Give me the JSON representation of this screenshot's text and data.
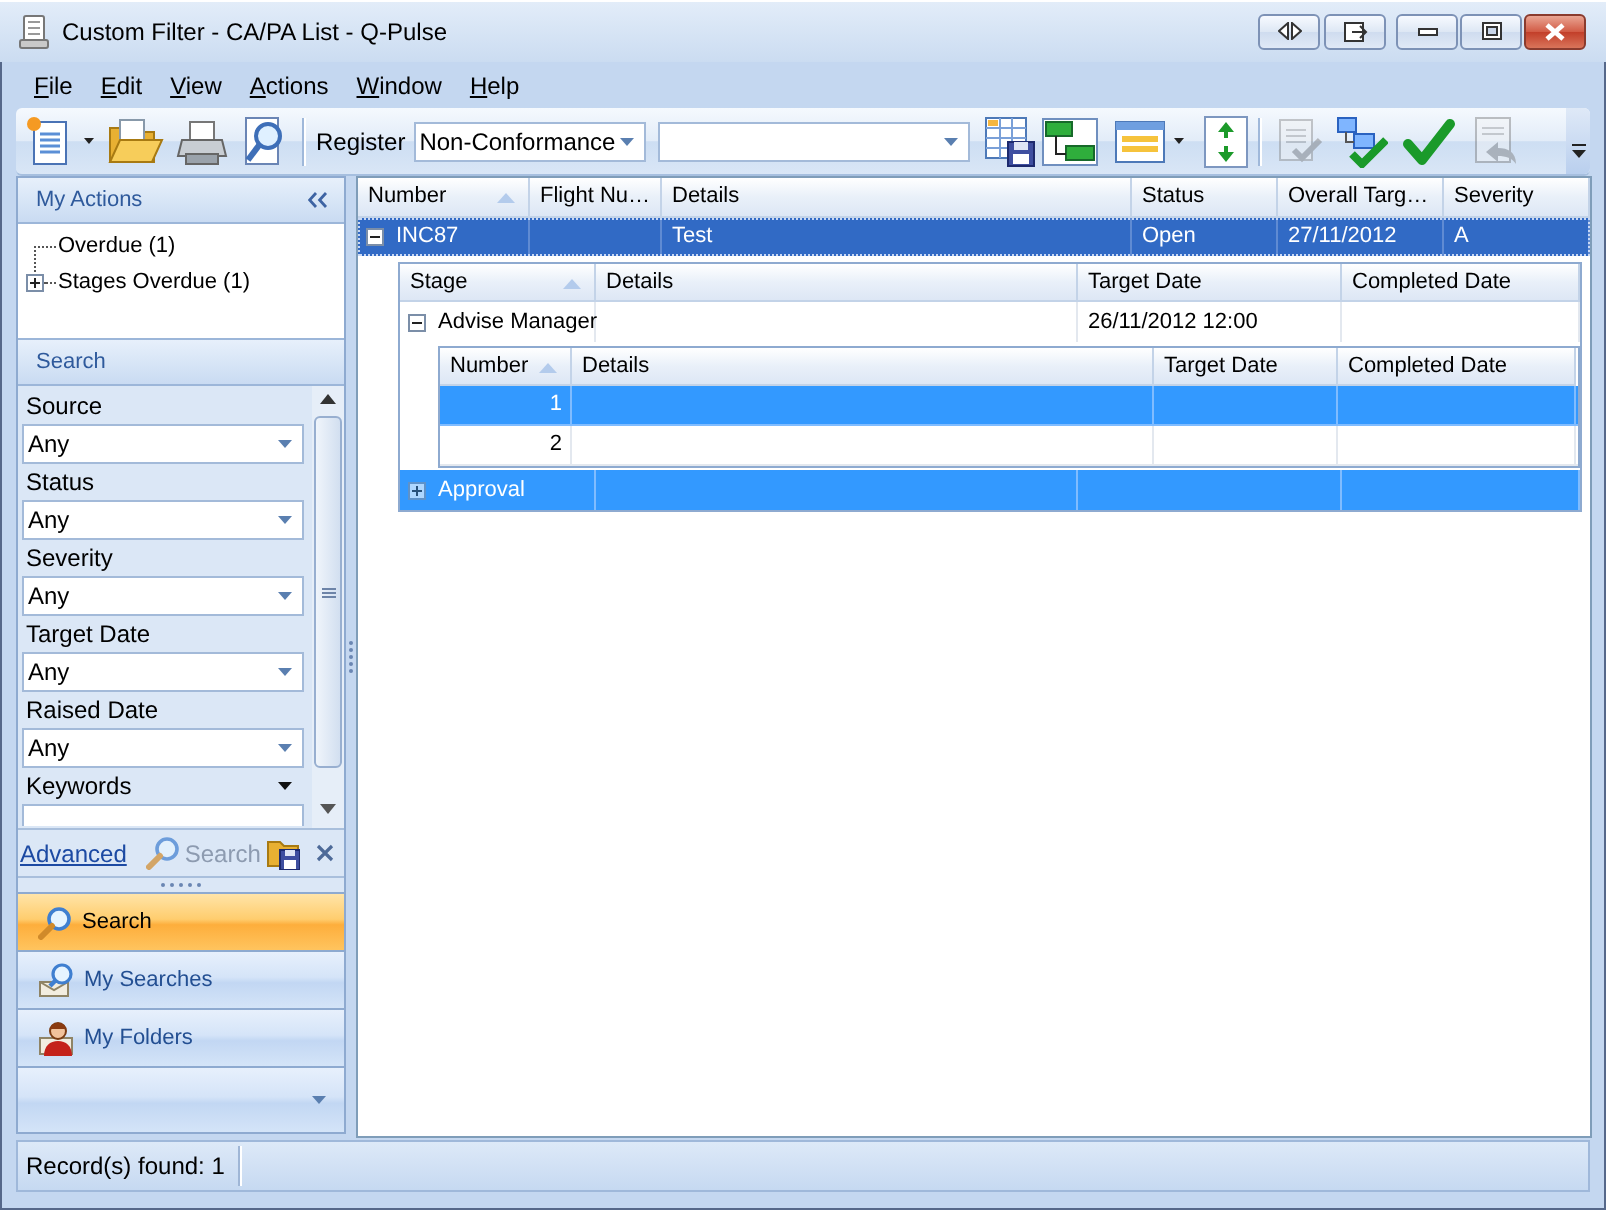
{
  "window": {
    "title": "Custom Filter - CA/PA List - Q-Pulse"
  },
  "menu": [
    "File",
    "Edit",
    "View",
    "Actions",
    "Window",
    "Help"
  ],
  "toolbar": {
    "register_label": "Register",
    "register_value": "Non-Conformance",
    "workflow_tools": [
      {
        "disabled": true
      },
      {
        "disabled": false
      },
      {
        "disabled": false
      },
      {
        "disabled": true
      }
    ]
  },
  "my_actions": {
    "title": "My Actions",
    "items": [
      {
        "label": "Overdue (1)",
        "kind": "leaf"
      },
      {
        "label": "Stages Overdue (1)",
        "kind": "group",
        "expanded": false
      }
    ]
  },
  "search_panel": {
    "title": "Search",
    "fields": [
      {
        "kind": "dropdown",
        "label": "Source",
        "value": "Any"
      },
      {
        "kind": "dropdown",
        "label": "Status",
        "value": "Any"
      },
      {
        "kind": "dropdown",
        "label": "Severity",
        "value": "Any"
      },
      {
        "kind": "dropdown",
        "label": "Target Date",
        "value": "Any"
      },
      {
        "kind": "dropdown",
        "label": "Raised Date",
        "value": "Any"
      },
      {
        "kind": "text",
        "label": "Keywords"
      }
    ],
    "advanced_link": "Advanced",
    "search_button": {
      "label": "Search",
      "disabled": true
    }
  },
  "navigation": [
    {
      "label": "Search",
      "selected": true
    },
    {
      "label": "My Searches",
      "selected": false
    },
    {
      "label": "My Folders",
      "selected": false
    }
  ],
  "grid": {
    "columns": [
      {
        "label": "Number",
        "sorted": true
      },
      {
        "label": "Flight Nu…",
        "sorted": false
      },
      {
        "label": "Details",
        "sorted": false
      },
      {
        "label": "Status",
        "sorted": false
      },
      {
        "label": "Overall Targ…",
        "sorted": false
      },
      {
        "label": "Severity",
        "sorted": false
      }
    ],
    "rows": [
      {
        "cells": [
          "INC87",
          null,
          "Test",
          "Open",
          "27/11/2012",
          "A"
        ],
        "selected": true,
        "focused": true,
        "expanded": true,
        "detail_grid": {
          "columns": [
            {
              "label": "Stage",
              "sorted": true
            },
            {
              "label": "Details",
              "sorted": false
            },
            {
              "label": "Target Date",
              "sorted": false
            },
            {
              "label": "Completed Date",
              "sorted": false
            }
          ],
          "rows": [
            {
              "cells": [
                "Advise Manager",
                null,
                "26/11/2012 12:00",
                null
              ],
              "selected": false,
              "focused": false,
              "expanded": true,
              "detail_grid": {
                "columns": [
                  {
                    "label": "Number",
                    "sorted": true
                  },
                  {
                    "label": "Details",
                    "sorted": false
                  },
                  {
                    "label": "Target Date",
                    "sorted": false
                  },
                  {
                    "label": "Completed Date",
                    "sorted": false
                  }
                ],
                "rows": [
                  {
                    "cells": [
                      "1",
                      null,
                      null,
                      null
                    ],
                    "selected": true,
                    "focused": false
                  },
                  {
                    "cells": [
                      "2",
                      null,
                      null,
                      null
                    ],
                    "selected": false,
                    "focused": false
                  }
                ]
              }
            },
            {
              "cells": [
                "Approval",
                null,
                null,
                null
              ],
              "selected": true,
              "focused": false,
              "expanded": false
            }
          ]
        }
      }
    ]
  },
  "status_bar": {
    "text": "Record(s) found: 1"
  }
}
